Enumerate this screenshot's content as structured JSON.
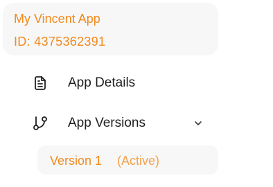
{
  "app": {
    "name": "My Vincent App",
    "id_label": "ID: 4375362391"
  },
  "nav": {
    "details": {
      "label": "App Details",
      "icon": "document-icon"
    },
    "versions": {
      "label": "App Versions",
      "icon": "git-branch-icon",
      "expanded": true
    }
  },
  "versions": [
    {
      "name": "Version 1",
      "status": "(Active)"
    }
  ],
  "colors": {
    "accent": "#f28a1e",
    "accent_light": "#f3a14a",
    "card_bg": "#f7f7f7",
    "text": "#1f1f1f"
  }
}
